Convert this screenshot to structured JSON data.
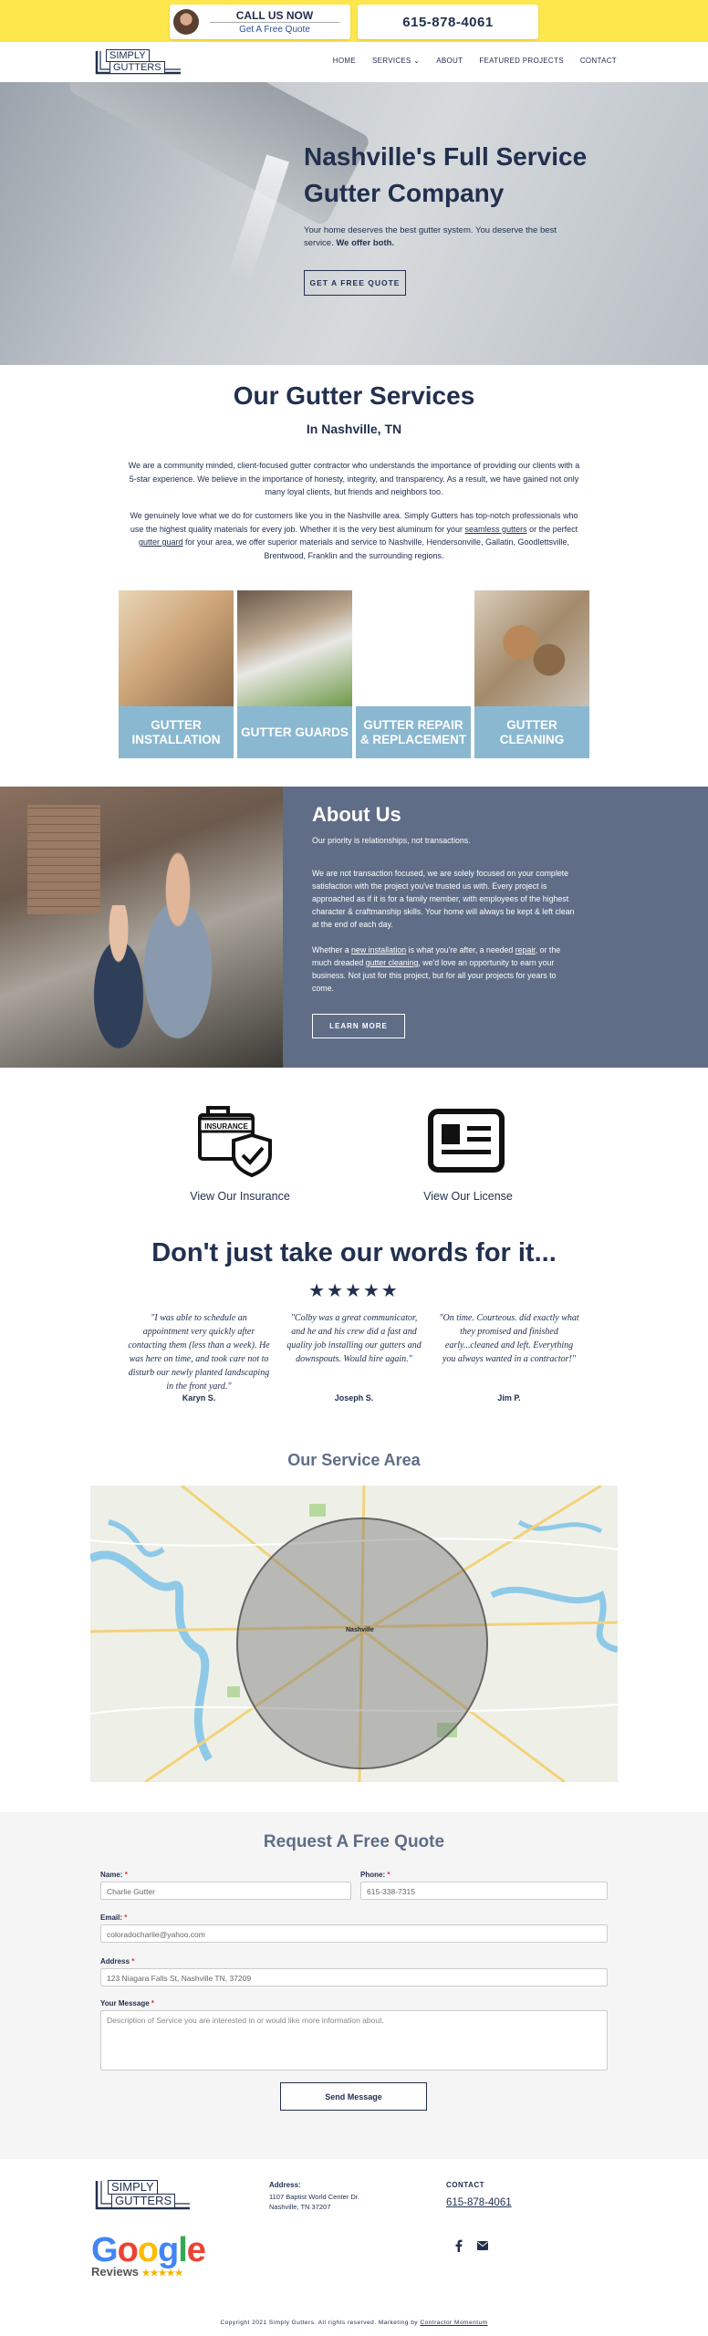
{
  "topbar": {
    "call_now": "CALL US NOW",
    "free_quote": "Get A Free Quote",
    "phone": "615-878-4061"
  },
  "nav": {
    "logo_line1": "SIMPLY",
    "logo_line2": "GUTTERS",
    "items": [
      "HOME",
      "SERVICES",
      "ABOUT",
      "FEATURED PROJECTS",
      "CONTACT"
    ]
  },
  "hero": {
    "title": "Nashville's Full Service Gutter Company",
    "subtitle": "Your home deserves the best gutter system. You deserve the best service.",
    "subtitle_bold": "We offer both.",
    "button": "GET A FREE QUOTE"
  },
  "services": {
    "title": "Our Gutter Services",
    "subtitle": "In Nashville, TN",
    "para1": "We are a community minded, client-focused gutter contractor who understands the importance of providing our clients with a 5-star experience. We believe in the importance of honesty, integrity, and transparency. As a result, we have gained not only many loyal clients, but friends and neighbors too.",
    "para2_a": "We genuinely love what we do for customers like you in the Nashville area. Simply Gutters has top-notch professionals who use the highest quality materials for every job. Whether it is the very best aluminum for your ",
    "para2_link1": "seamless gutters",
    "para2_b": " or the perfect ",
    "para2_link2": "gutter guard",
    "para2_c": " for your area, we offer superior materials and service to Nashville, Hendersonville, Gallatin, Goodlettsville, Brentwood, Franklin and the surrounding regions.",
    "tiles": [
      "GUTTER INSTALLATION",
      "GUTTER GUARDS",
      "GUTTER REPAIR & REPLACEMENT",
      "GUTTER CLEANING"
    ]
  },
  "about": {
    "title": "About Us",
    "tagline": "Our priority is relationships, not transactions.",
    "para1": "We are not transaction focused, we are solely focused on your complete satisfaction with the project you've trusted us with. Every project is approached as if it is for a family member, with employees of the highest character & craftmanship skills. Your home will always be kept & left clean at the end of each day.",
    "para2_a": "Whether a ",
    "para2_link1": "new installation",
    "para2_b": " is what you're after, a needed ",
    "para2_link2": "repair",
    "para2_c": ", or the much dreaded ",
    "para2_link3": "gutter cleaning",
    "para2_d": ", we'd love an opportunity to earn your business. Not just for this project, but for all your projects for years to come.",
    "button": "LEARN MORE"
  },
  "credentials": {
    "insurance_badge": "INSURANCE",
    "insurance_label": "View Our Insurance",
    "license_label": "View Our License"
  },
  "testimonials": {
    "title": "Don't just take our words for it...",
    "stars": "★★★★★",
    "items": [
      {
        "quote": "\"I was able to schedule an appointment very quickly after contacting them (less than a week). He was here on time, and took care not to disturb our newly planted landscaping in the front yard.\"",
        "name": "Karyn S."
      },
      {
        "quote": "\"Colby was a great communicator, and he and his crew did a fast and quality job installing our gutters and downspouts. Would hire again.\"",
        "name": "Joseph S."
      },
      {
        "quote": "\"On time. Courteous. did exactly what they promised and finished early...cleaned and left. Everything you always wanted in a contractor!\"",
        "name": "Jim P."
      }
    ]
  },
  "service_area": {
    "title": "Our Service Area",
    "city": "Nashville"
  },
  "quote_form": {
    "title": "Request A Free Quote",
    "name_label": "Name:",
    "name_value": "Charlie Gutter",
    "phone_label": "Phone:",
    "phone_value": "615-338-7315",
    "email_label": "Email:",
    "email_value": "coloradocharlie@yahoo.com",
    "address_label": "Address",
    "address_value": "123 Niagara Falls St, Nashville TN, 37209",
    "message_label": "Your Message",
    "message_placeholder": "Description of Service you are interested in or would like more information about.",
    "required_mark": "*",
    "submit": "Send Message"
  },
  "footer": {
    "address_label": "Address:",
    "address_line1": "1107 Baptist World Center Dr.",
    "address_line2": "Nashville, TN 37207",
    "contact_label": "CONTACT",
    "contact_phone": "615-878-4061",
    "google_word": "Google",
    "reviews_word": "Reviews",
    "review_stars": "★★★★★",
    "copyright": "Copyright 2021 Simply Gutters. All rights reserved. Marketing by ",
    "copyright_link": "Contractor Momentum"
  },
  "colors": {
    "navy": "#22304f",
    "topbar_yellow": "#fde74c",
    "tile_blue": "#8bb8d1",
    "about_slate": "#5f6d87"
  },
  "icons": [
    "insurance-briefcase-icon",
    "license-card-icon",
    "facebook-icon",
    "email-icon",
    "chevron-down-icon"
  ]
}
